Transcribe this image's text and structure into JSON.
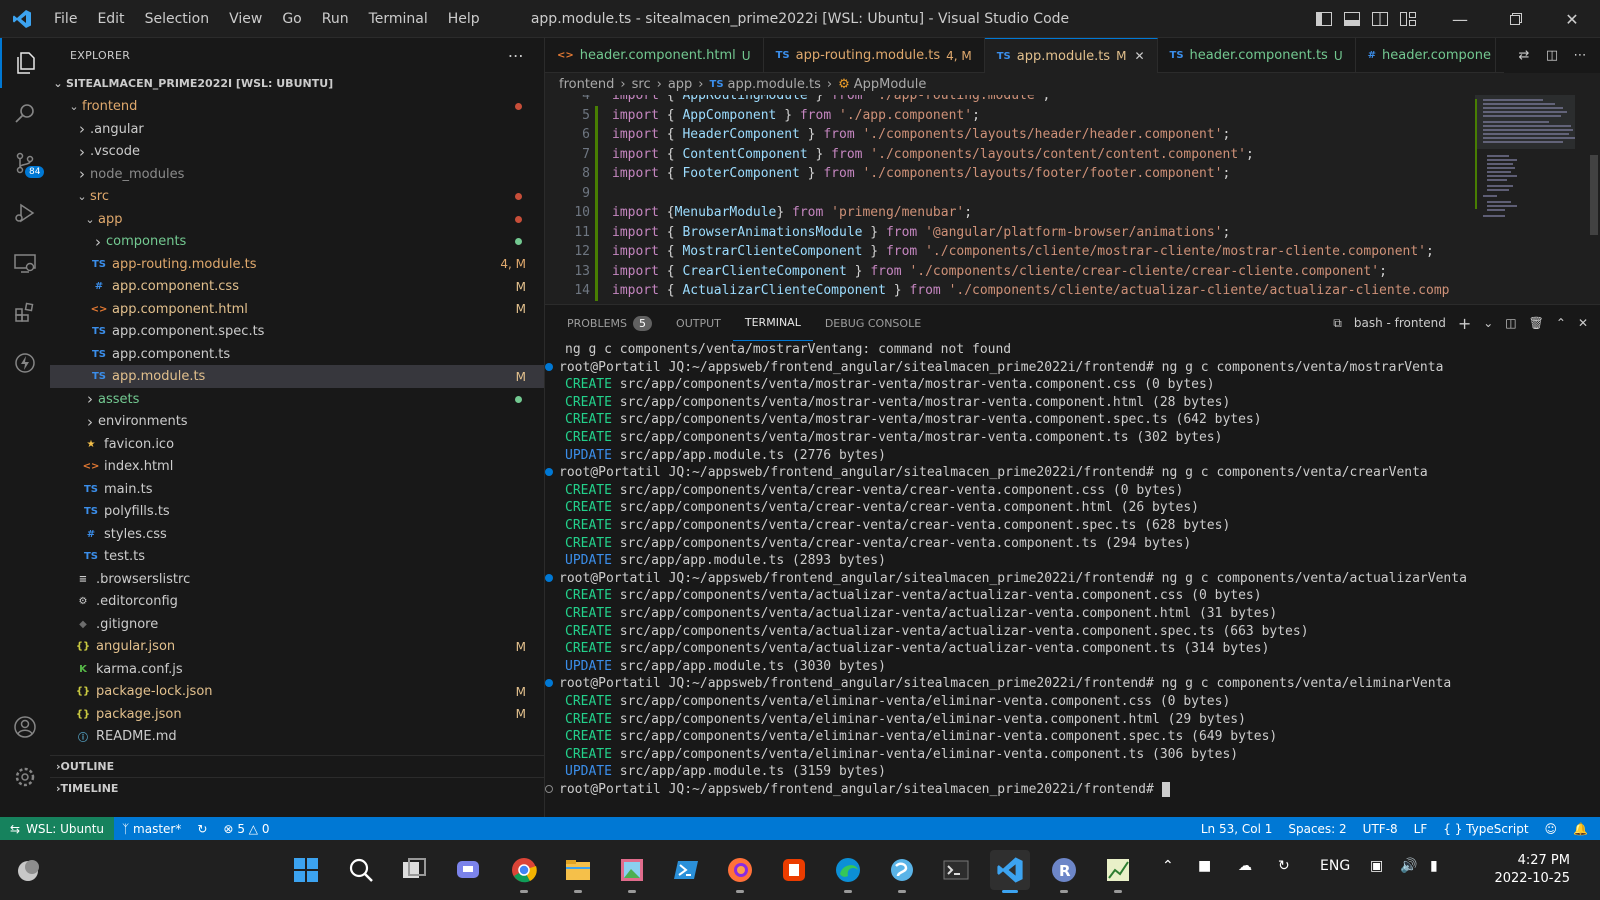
{
  "titlebar": {
    "menu": [
      "File",
      "Edit",
      "Selection",
      "View",
      "Go",
      "Run",
      "Terminal",
      "Help"
    ],
    "title": "app.module.ts - sitealmacen_prime2022i [WSL: Ubuntu] - Visual Studio Code"
  },
  "activity_badge": "84",
  "explorer": {
    "header": "EXPLORER",
    "root": "SITEALMACEN_PRIME2022I [WSL: UBUNTU]",
    "items": [
      {
        "label": "frontend",
        "kind": "folder-open",
        "depth": 1,
        "color": "#e0a96d",
        "dot": "#c74e39"
      },
      {
        "label": ".angular",
        "kind": "folder",
        "depth": 2,
        "color": "#cccccc"
      },
      {
        "label": ".vscode",
        "kind": "folder",
        "depth": 2,
        "color": "#cccccc"
      },
      {
        "label": "node_modules",
        "kind": "folder",
        "depth": 2,
        "color": "#8b8b8b"
      },
      {
        "label": "src",
        "kind": "folder-open",
        "depth": 2,
        "color": "#e0a96d",
        "dot": "#c74e39"
      },
      {
        "label": "app",
        "kind": "folder-open",
        "depth": 3,
        "color": "#e0a96d",
        "dot": "#c74e39"
      },
      {
        "label": "components",
        "kind": "folder",
        "depth": 4,
        "color": "#73c991",
        "dot": "#73c991"
      },
      {
        "label": "app-routing.module.ts",
        "kind": "ts",
        "depth": 4,
        "color": "#e0a96d",
        "badge": "4, M"
      },
      {
        "label": "app.component.css",
        "kind": "css",
        "depth": 4,
        "color": "#e2c08d",
        "badge": "M"
      },
      {
        "label": "app.component.html",
        "kind": "html",
        "depth": 4,
        "color": "#e2c08d",
        "badge": "M"
      },
      {
        "label": "app.component.spec.ts",
        "kind": "ts",
        "depth": 4,
        "color": "#cccccc"
      },
      {
        "label": "app.component.ts",
        "kind": "ts",
        "depth": 4,
        "color": "#cccccc"
      },
      {
        "label": "app.module.ts",
        "kind": "ts",
        "depth": 4,
        "color": "#e2c08d",
        "badge": "M",
        "selected": true
      },
      {
        "label": "assets",
        "kind": "folder",
        "depth": 3,
        "color": "#73c991",
        "dot": "#73c991"
      },
      {
        "label": "environments",
        "kind": "folder",
        "depth": 3,
        "color": "#cccccc"
      },
      {
        "label": "favicon.ico",
        "kind": "star",
        "depth": 3,
        "color": "#cccccc"
      },
      {
        "label": "index.html",
        "kind": "html",
        "depth": 3,
        "color": "#cccccc"
      },
      {
        "label": "main.ts",
        "kind": "ts",
        "depth": 3,
        "color": "#cccccc"
      },
      {
        "label": "polyfills.ts",
        "kind": "ts",
        "depth": 3,
        "color": "#cccccc"
      },
      {
        "label": "styles.css",
        "kind": "css",
        "depth": 3,
        "color": "#cccccc"
      },
      {
        "label": "test.ts",
        "kind": "ts",
        "depth": 3,
        "color": "#cccccc"
      },
      {
        "label": ".browserslistrc",
        "kind": "lines",
        "depth": 2,
        "color": "#cccccc"
      },
      {
        "label": ".editorconfig",
        "kind": "gear",
        "depth": 2,
        "color": "#cccccc"
      },
      {
        "label": ".gitignore",
        "kind": "diamond",
        "depth": 2,
        "color": "#cccccc"
      },
      {
        "label": "angular.json",
        "kind": "json",
        "depth": 2,
        "color": "#e2c08d",
        "badge": "M"
      },
      {
        "label": "karma.conf.js",
        "kind": "karma",
        "depth": 2,
        "color": "#cccccc"
      },
      {
        "label": "package-lock.json",
        "kind": "json",
        "depth": 2,
        "color": "#e2c08d",
        "badge": "M"
      },
      {
        "label": "package.json",
        "kind": "json",
        "depth": 2,
        "color": "#e2c08d",
        "badge": "M"
      },
      {
        "label": "README.md",
        "kind": "info",
        "depth": 2,
        "color": "#cccccc"
      }
    ],
    "outline": "OUTLINE",
    "timeline": "TIMELINE"
  },
  "tabs": [
    {
      "icon": "<>",
      "label": "header.component.html",
      "mark": "U",
      "color": "#73c991"
    },
    {
      "icon": "TS",
      "label": "app-routing.module.ts",
      "mark": "4, M",
      "color": "#e0a96d"
    },
    {
      "icon": "TS",
      "label": "app.module.ts",
      "mark": "M",
      "color": "#e2c08d",
      "active": true
    },
    {
      "icon": "TS",
      "label": "header.component.ts",
      "mark": "U",
      "color": "#73c991"
    },
    {
      "icon": "#",
      "label": "header.compone",
      "mark": "",
      "color": "#73c991"
    }
  ],
  "breadcrumb": [
    "frontend",
    "src",
    "app",
    "app.module.ts",
    "AppModule"
  ],
  "code": [
    {
      "n": "4",
      "parts": [
        [
          "kw",
          "import"
        ],
        [
          "pun",
          " { "
        ],
        [
          "id",
          "AppRoutingModule"
        ],
        [
          "pun",
          " } "
        ],
        [
          "kw",
          "from"
        ],
        [
          "str",
          " './app-routing.module'"
        ],
        [
          "pun",
          ";"
        ]
      ]
    },
    {
      "n": "5",
      "parts": [
        [
          "kw",
          "import"
        ],
        [
          "pun",
          " { "
        ],
        [
          "id",
          "AppComponent"
        ],
        [
          "pun",
          " } "
        ],
        [
          "kw",
          "from"
        ],
        [
          "str",
          " './app.component'"
        ],
        [
          "pun",
          ";"
        ]
      ]
    },
    {
      "n": "6",
      "parts": [
        [
          "kw",
          "import"
        ],
        [
          "pun",
          " { "
        ],
        [
          "id",
          "HeaderComponent"
        ],
        [
          "pun",
          " } "
        ],
        [
          "kw",
          "from"
        ],
        [
          "str",
          " './components/layouts/header/header.component'"
        ],
        [
          "pun",
          ";"
        ]
      ]
    },
    {
      "n": "7",
      "parts": [
        [
          "kw",
          "import"
        ],
        [
          "pun",
          " { "
        ],
        [
          "id",
          "ContentComponent"
        ],
        [
          "pun",
          " } "
        ],
        [
          "kw",
          "from"
        ],
        [
          "str",
          " './components/layouts/content/content.component'"
        ],
        [
          "pun",
          ";"
        ]
      ]
    },
    {
      "n": "8",
      "parts": [
        [
          "kw",
          "import"
        ],
        [
          "pun",
          " { "
        ],
        [
          "id",
          "FooterComponent"
        ],
        [
          "pun",
          " } "
        ],
        [
          "kw",
          "from"
        ],
        [
          "str",
          " './components/layouts/footer/footer.component'"
        ],
        [
          "pun",
          ";"
        ]
      ]
    },
    {
      "n": "9",
      "parts": []
    },
    {
      "n": "10",
      "parts": [
        [
          "kw",
          "import"
        ],
        [
          "pun",
          " {"
        ],
        [
          "id",
          "MenubarModule"
        ],
        [
          "pun",
          "} "
        ],
        [
          "kw",
          "from"
        ],
        [
          "str",
          " 'primeng/menubar'"
        ],
        [
          "pun",
          ";"
        ]
      ]
    },
    {
      "n": "11",
      "parts": [
        [
          "kw",
          "import"
        ],
        [
          "pun",
          " { "
        ],
        [
          "id",
          "BrowserAnimationsModule"
        ],
        [
          "pun",
          " } "
        ],
        [
          "kw",
          "from"
        ],
        [
          "str",
          " '@angular/platform-browser/animations'"
        ],
        [
          "pun",
          ";"
        ]
      ]
    },
    {
      "n": "12",
      "parts": [
        [
          "kw",
          "import"
        ],
        [
          "pun",
          " { "
        ],
        [
          "id",
          "MostrarClienteComponent"
        ],
        [
          "pun",
          " } "
        ],
        [
          "kw",
          "from"
        ],
        [
          "str",
          " './components/cliente/mostrar-cliente/mostrar-cliente.component'"
        ],
        [
          "pun",
          ";"
        ]
      ]
    },
    {
      "n": "13",
      "parts": [
        [
          "kw",
          "import"
        ],
        [
          "pun",
          " { "
        ],
        [
          "id",
          "CrearClienteComponent"
        ],
        [
          "pun",
          " } "
        ],
        [
          "kw",
          "from"
        ],
        [
          "str",
          " './components/cliente/crear-cliente/crear-cliente.component'"
        ],
        [
          "pun",
          ";"
        ]
      ]
    },
    {
      "n": "14",
      "parts": [
        [
          "kw",
          "import"
        ],
        [
          "pun",
          " { "
        ],
        [
          "id",
          "ActualizarClienteComponent"
        ],
        [
          "pun",
          " } "
        ],
        [
          "kw",
          "from"
        ],
        [
          "str",
          " './components/cliente/actualizar-cliente/actualizar-cliente.comp"
        ]
      ]
    }
  ],
  "panel": {
    "tabs": [
      "PROBLEMS",
      "OUTPUT",
      "TERMINAL",
      "DEBUG CONSOLE"
    ],
    "problems_count": "5",
    "shell": "bash - frontend"
  },
  "terminal": [
    {
      "type": "plain",
      "text": "ng g c components/venta/mostrarVentang: command not found"
    },
    {
      "type": "prompt",
      "text": "root@Portatil JQ:~/appsweb/frontend_angular/sitealmacen_prime2022i/frontend# ng g c components/venta/mostrarVenta"
    },
    {
      "type": "create",
      "tag": "CREATE",
      "text": " src/app/components/venta/mostrar-venta/mostrar-venta.component.css (0 bytes)"
    },
    {
      "type": "create",
      "tag": "CREATE",
      "text": " src/app/components/venta/mostrar-venta/mostrar-venta.component.html (28 bytes)"
    },
    {
      "type": "create",
      "tag": "CREATE",
      "text": " src/app/components/venta/mostrar-venta/mostrar-venta.component.spec.ts (642 bytes)"
    },
    {
      "type": "create",
      "tag": "CREATE",
      "text": " src/app/components/venta/mostrar-venta/mostrar-venta.component.ts (302 bytes)"
    },
    {
      "type": "update",
      "tag": "UPDATE",
      "text": " src/app/app.module.ts (2776 bytes)"
    },
    {
      "type": "prompt",
      "text": "root@Portatil JQ:~/appsweb/frontend_angular/sitealmacen_prime2022i/frontend# ng g c components/venta/crearVenta"
    },
    {
      "type": "create",
      "tag": "CREATE",
      "text": " src/app/components/venta/crear-venta/crear-venta.component.css (0 bytes)"
    },
    {
      "type": "create",
      "tag": "CREATE",
      "text": " src/app/components/venta/crear-venta/crear-venta.component.html (26 bytes)"
    },
    {
      "type": "create",
      "tag": "CREATE",
      "text": " src/app/components/venta/crear-venta/crear-venta.component.spec.ts (628 bytes)"
    },
    {
      "type": "create",
      "tag": "CREATE",
      "text": " src/app/components/venta/crear-venta/crear-venta.component.ts (294 bytes)"
    },
    {
      "type": "update",
      "tag": "UPDATE",
      "text": " src/app/app.module.ts (2893 bytes)"
    },
    {
      "type": "prompt",
      "text": "root@Portatil JQ:~/appsweb/frontend_angular/sitealmacen_prime2022i/frontend# ng g c components/venta/actualizarVenta"
    },
    {
      "type": "create",
      "tag": "CREATE",
      "text": " src/app/components/venta/actualizar-venta/actualizar-venta.component.css (0 bytes)"
    },
    {
      "type": "create",
      "tag": "CREATE",
      "text": " src/app/components/venta/actualizar-venta/actualizar-venta.component.html (31 bytes)"
    },
    {
      "type": "create",
      "tag": "CREATE",
      "text": " src/app/components/venta/actualizar-venta/actualizar-venta.component.spec.ts (663 bytes)"
    },
    {
      "type": "create",
      "tag": "CREATE",
      "text": " src/app/components/venta/actualizar-venta/actualizar-venta.component.ts (314 bytes)"
    },
    {
      "type": "update",
      "tag": "UPDATE",
      "text": " src/app/app.module.ts (3030 bytes)"
    },
    {
      "type": "prompt",
      "text": "root@Portatil JQ:~/appsweb/frontend_angular/sitealmacen_prime2022i/frontend# ng g c components/venta/eliminarVenta"
    },
    {
      "type": "create",
      "tag": "CREATE",
      "text": " src/app/components/venta/eliminar-venta/eliminar-venta.component.css (0 bytes)"
    },
    {
      "type": "create",
      "tag": "CREATE",
      "text": " src/app/components/venta/eliminar-venta/eliminar-venta.component.html (29 bytes)"
    },
    {
      "type": "create",
      "tag": "CREATE",
      "text": " src/app/components/venta/eliminar-venta/eliminar-venta.component.spec.ts (649 bytes)"
    },
    {
      "type": "create",
      "tag": "CREATE",
      "text": " src/app/components/venta/eliminar-venta/eliminar-venta.component.ts (306 bytes)"
    },
    {
      "type": "update",
      "tag": "UPDATE",
      "text": " src/app/app.module.ts (3159 bytes)"
    },
    {
      "type": "current",
      "text": "root@Portatil JQ:~/appsweb/frontend_angular/sitealmacen_prime2022i/frontend# "
    }
  ],
  "status": {
    "remote": "WSL: Ubuntu",
    "branch": "master*",
    "errors": "5",
    "warnings": "0",
    "position": "Ln 53, Col 1",
    "spaces": "Spaces: 2",
    "encoding": "UTF-8",
    "eol": "LF",
    "language": "TypeScript"
  },
  "taskbar": {
    "lang": "ENG",
    "time": "4:27 PM",
    "date": "2022-10-25"
  },
  "colors": {
    "accent": "#0078d4",
    "remote": "#16825d",
    "create": "#23d18b",
    "update": "#3b8eea"
  }
}
